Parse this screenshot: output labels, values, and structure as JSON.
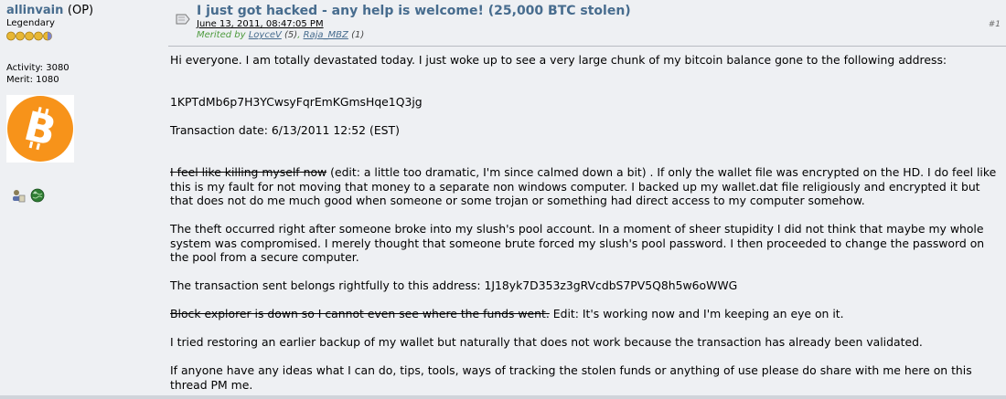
{
  "sidebar": {
    "username": "allinvain",
    "op_tag": "(OP)",
    "rank": "Legendary",
    "activity": "Activity: 3080",
    "merit": "Merit: 1080",
    "avatar_icon": "bitcoin-logo-icon",
    "profile_icons": [
      "profile-icon",
      "globe-icon"
    ]
  },
  "post": {
    "subject": "I just got hacked - any help is welcome! (25,000 BTC stolen)",
    "date": "June 13, 2011, 08:47:05 PM",
    "merited_by_label": "Merited by",
    "merit_givers": [
      {
        "name": "LoyceV",
        "count": "(5)"
      },
      {
        "name": "Raja_MBZ",
        "count": "(1)"
      }
    ],
    "post_number": "#1",
    "body": {
      "p1": "Hi everyone. I am totally devastated today. I just woke up to see a very large chunk of my bitcoin balance gone to the following address:",
      "address1": "1KPTdMb6p7H3YCwsyFqrEmKGmsHqe1Q3jg",
      "tx_date": "Transaction date: 6/13/2011 12:52 (EST)",
      "p4_strike": "I feel like killing myself now",
      "p4_rest": " (edit: a little too dramatic, I'm since calmed down a bit) . If only the wallet file was encrypted on the HD. I do feel like this is my fault for not moving that money to a separate non windows computer. I backed up my wallet.dat file religiously and encrypted it but that does not do me much good when someone or some trojan or something had direct access to my computer somehow.",
      "p5": "The theft occurred right after someone broke into my slush's pool account. In a moment of sheer stupidity I did not think that maybe my whole system was compromised. I merely thought that someone brute forced my slush's pool password. I then proceeded to change the password on the pool from a secure computer.",
      "p6": "The transaction sent belongs rightfully to this address: 1J18yk7D353z3gRVcdbS7PV5Q8h5w6oWWG",
      "p7_strike": "Block explorer is down so I cannot even see where the funds went.",
      "p7_rest": " Edit: It's working now and I'm keeping an eye on it.",
      "p8": "I tried restoring an earlier backup of my wallet but naturally that does not work because the transaction has already been validated.",
      "p9": "If anyone have any ideas what I can do, tips, tools, ways of tracking the stolen funds or anything of use please do share with me here on this thread PM me."
    }
  },
  "colors": {
    "background": "#eef0f3",
    "link": "#476c8e",
    "merit_green": "#4d9a3d",
    "bitcoin_orange": "#f7931a"
  }
}
